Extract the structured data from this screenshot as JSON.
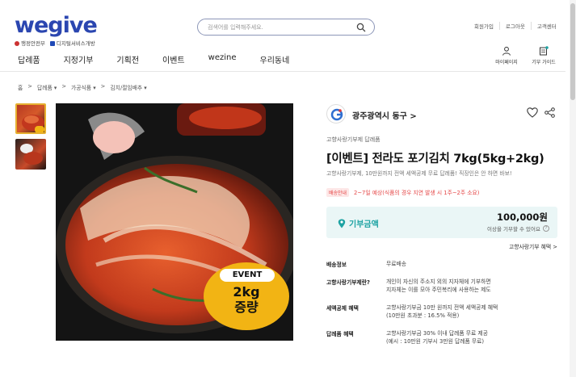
{
  "brand": {
    "logo": "wegive",
    "sub1": "행정안전부",
    "sub2": "디지털서비스개방"
  },
  "search": {
    "placeholder": "검색어를 입력해주세요."
  },
  "util_links": [
    "회원가입",
    "로그아웃",
    "고객센터"
  ],
  "nav": [
    "답례품",
    "지정기부",
    "기획전",
    "이벤트",
    "wezine",
    "우리동네"
  ],
  "right_icons": [
    {
      "label": "마이페이지",
      "icon": "user-icon"
    },
    {
      "label": "기부 가이드",
      "icon": "guide-icon",
      "badge_color": "#1ea3a3"
    }
  ],
  "breadcrumb": [
    "홈",
    "답례품 ▾",
    "가공식품 ▾",
    "김치/절임배추 ▾"
  ],
  "product": {
    "seller": "광주광역시 동구 >",
    "category": "고향사랑기부제 답례품",
    "title": "[이벤트] 전라도 포기김치 7kg(5kg+2kg)",
    "desc": "고향사랑기부제, 10만원까지 전액 세액공제 무료 답례품! 직장인은 안 하면 바보!",
    "ship_badge": "배송안내",
    "ship_text": "2~7일 예상(식품의 경우 지연 발생 시 1주~2주 소요)",
    "donate_label": "기부금액",
    "donate_amount": "100,000원",
    "donate_note": "이상을 기부할 수 있어요",
    "benefit_link": "고향사랑기부 혜택 >",
    "event": {
      "pill": "EVENT",
      "main": "2kg\n증량"
    },
    "info": [
      {
        "k": "배송정보",
        "v": "무료배송"
      },
      {
        "k": "고향사랑기부제란?",
        "v": "개인이 자신의 주소지 외의 지자체에 기부하면\n지자체는 이를 모아 주민복리에 사용하는 제도"
      },
      {
        "k": "세액공제 혜택",
        "v": "고향사랑기부금 10만 원까지 전액 세액공제 혜택\n(10만원 초과분 : 16.5% 적용)"
      },
      {
        "k": "답례품 혜택",
        "v": "고향사랑기부금 30% 이내 답례품 무료 제공\n(예시 : 10만원 기부시 3만원 답례품 무료)"
      }
    ]
  },
  "colors": {
    "brand": "#2b46b0",
    "accent_teal": "#1ea3a3",
    "event_yellow": "#f2b414",
    "ship_red": "#e54848"
  }
}
